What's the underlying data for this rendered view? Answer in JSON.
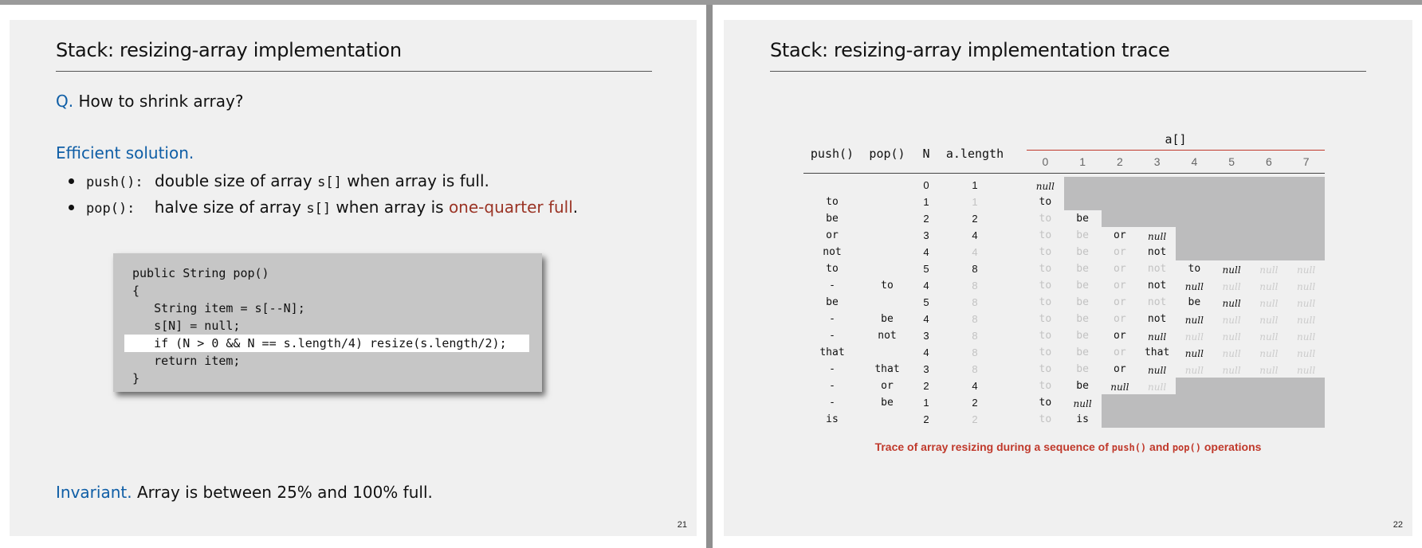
{
  "left_slide": {
    "title": "Stack:  resizing-array implementation",
    "question_label": "Q.",
    "question_text": "How to shrink array?",
    "solution_heading": "Efficient solution.",
    "bullets": [
      {
        "code": "push():",
        "text_a": "double size of array",
        "code2": "s[]",
        "text_b": "when array is full.",
        "highlight": ""
      },
      {
        "code": "pop():",
        "text_a": "halve size of array",
        "code2": "s[]",
        "text_b": "when array is",
        "highlight": "one-quarter full"
      }
    ],
    "period": ".",
    "code_lines": [
      "public String pop()",
      "{",
      "   String item = s[--N];",
      "   s[N] = null;",
      "   if (N > 0 && N == s.length/4) resize(s.length/2);",
      "   return item;",
      "}"
    ],
    "invariant_label": "Invariant.",
    "invariant_text": "Array is between 25% and 100% full.",
    "page_number": "21"
  },
  "right_slide": {
    "title": "Stack:  resizing-array implementation trace",
    "array_label": "a[]",
    "headers": {
      "push": "push()",
      "pop": "pop()",
      "n": "N",
      "length": "a.length"
    },
    "indices": [
      "0",
      "1",
      "2",
      "3",
      "4",
      "5",
      "6",
      "7"
    ],
    "rows": [
      {
        "push": "",
        "pop": "",
        "n": "0",
        "len": "1",
        "len_faint": false,
        "a": [
          "null"
        ]
      },
      {
        "push": "to",
        "pop": "",
        "n": "1",
        "len": "1",
        "len_faint": true,
        "a": [
          "to"
        ]
      },
      {
        "push": "be",
        "pop": "",
        "n": "2",
        "len": "2",
        "len_faint": false,
        "a": [
          "to",
          "be"
        ]
      },
      {
        "push": "or",
        "pop": "",
        "n": "3",
        "len": "4",
        "len_faint": false,
        "a": [
          "to",
          "be",
          "or",
          "null"
        ]
      },
      {
        "push": "not",
        "pop": "",
        "n": "4",
        "len": "4",
        "len_faint": true,
        "a": [
          "to",
          "be",
          "or",
          "not"
        ]
      },
      {
        "push": "to",
        "pop": "",
        "n": "5",
        "len": "8",
        "len_faint": false,
        "a": [
          "to",
          "be",
          "or",
          "not",
          "to",
          "null",
          "null",
          "null"
        ]
      },
      {
        "push": "-",
        "pop": "to",
        "n": "4",
        "len": "8",
        "len_faint": true,
        "a": [
          "to",
          "be",
          "or",
          "not",
          "null",
          "null",
          "null",
          "null"
        ]
      },
      {
        "push": "be",
        "pop": "",
        "n": "5",
        "len": "8",
        "len_faint": true,
        "a": [
          "to",
          "be",
          "or",
          "not",
          "be",
          "null",
          "null",
          "null"
        ]
      },
      {
        "push": "-",
        "pop": "be",
        "n": "4",
        "len": "8",
        "len_faint": true,
        "a": [
          "to",
          "be",
          "or",
          "not",
          "null",
          "null",
          "null",
          "null"
        ]
      },
      {
        "push": "-",
        "pop": "not",
        "n": "3",
        "len": "8",
        "len_faint": true,
        "a": [
          "to",
          "be",
          "or",
          "null",
          "null",
          "null",
          "null",
          "null"
        ]
      },
      {
        "push": "that",
        "pop": "",
        "n": "4",
        "len": "8",
        "len_faint": true,
        "a": [
          "to",
          "be",
          "or",
          "that",
          "null",
          "null",
          "null",
          "null"
        ]
      },
      {
        "push": "-",
        "pop": "that",
        "n": "3",
        "len": "8",
        "len_faint": true,
        "a": [
          "to",
          "be",
          "or",
          "null",
          "null",
          "null",
          "null",
          "null"
        ]
      },
      {
        "push": "-",
        "pop": "or",
        "n": "2",
        "len": "4",
        "len_faint": false,
        "a": [
          "to",
          "be",
          "null",
          "null"
        ]
      },
      {
        "push": "-",
        "pop": "be",
        "n": "1",
        "len": "2",
        "len_faint": false,
        "a": [
          "to",
          "null"
        ]
      },
      {
        "push": "is",
        "pop": "",
        "n": "2",
        "len": "2",
        "len_faint": true,
        "a": [
          "to",
          "is"
        ]
      }
    ],
    "caption_pre": "Trace of array resizing during a sequence of",
    "caption_push": "push()",
    "caption_and": "and",
    "caption_pop": "pop()",
    "caption_post": "operations",
    "page_number": "22"
  },
  "colors": {
    "accent_blue": "#0f5ea6",
    "accent_red": "#9a3324",
    "caption_red": "#c0392b",
    "slide_bg": "#f0f0f0",
    "table_gray": "#bcbcbd"
  }
}
